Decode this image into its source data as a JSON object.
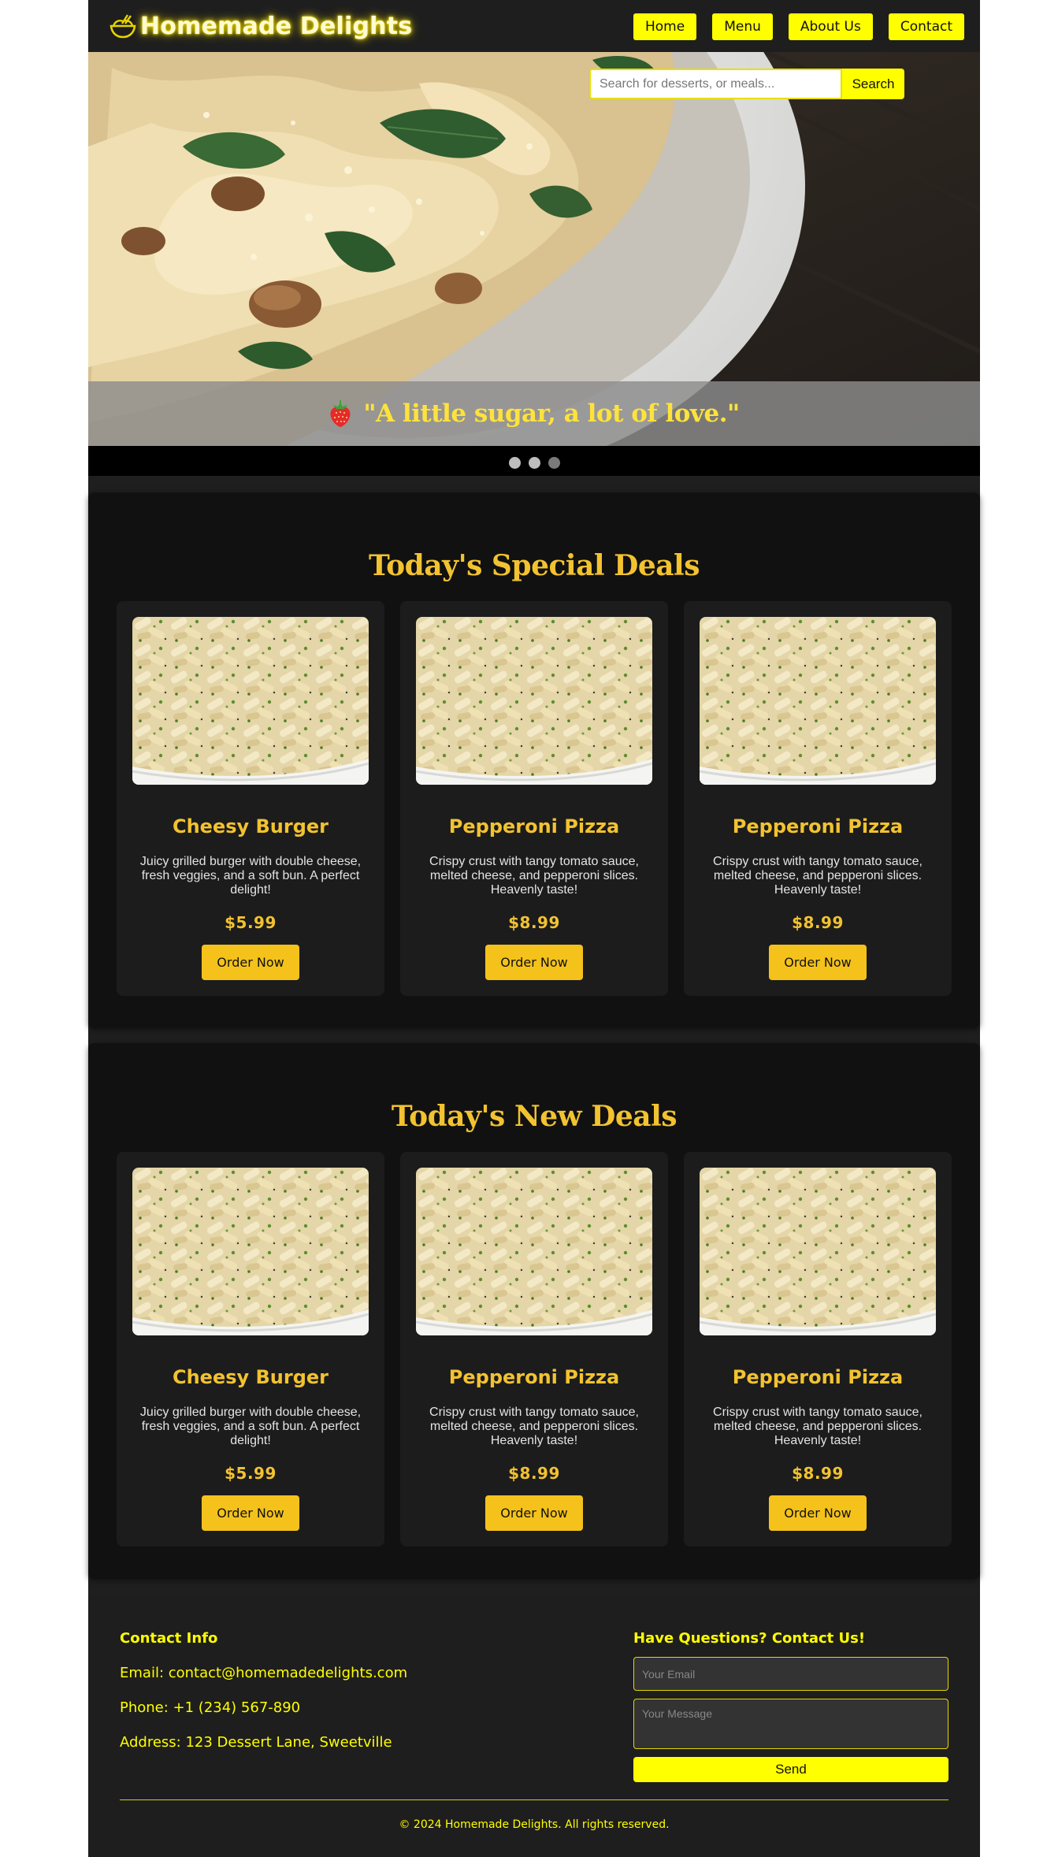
{
  "header": {
    "brand": "Homemade Delights",
    "logo_icon": "food-bowl-icon",
    "nav": [
      "Home",
      "Menu",
      "About Us",
      "Contact"
    ]
  },
  "hero": {
    "search": {
      "placeholder": "Search for desserts, or meals...",
      "value": "",
      "button": "Search"
    },
    "tagline": "\"A little sugar, a lot of love.\"",
    "tagline_icon": "strawberry-icon",
    "slides": 3,
    "active_slide": 1
  },
  "sections": [
    {
      "title": "Today's Special Deals",
      "items": [
        {
          "name": "Cheesy Burger",
          "description": "Juicy grilled burger with double cheese, fresh veggies, and a soft bun. A perfect delight!",
          "price": "$5.99",
          "button": "Order Now"
        },
        {
          "name": "Pepperoni Pizza",
          "description": "Crispy crust with tangy tomato sauce, melted cheese, and pepperoni slices. Heavenly taste!",
          "price": "$8.99",
          "button": "Order Now"
        },
        {
          "name": "Pepperoni Pizza",
          "description": "Crispy crust with tangy tomato sauce, melted cheese, and pepperoni slices. Heavenly taste!",
          "price": "$8.99",
          "button": "Order Now"
        }
      ]
    },
    {
      "title": "Today's New Deals",
      "items": [
        {
          "name": "Cheesy Burger",
          "description": "Juicy grilled burger with double cheese, fresh veggies, and a soft bun. A perfect delight!",
          "price": "$5.99",
          "button": "Order Now"
        },
        {
          "name": "Pepperoni Pizza",
          "description": "Crispy crust with tangy tomato sauce, melted cheese, and pepperoni slices. Heavenly taste!",
          "price": "$8.99",
          "button": "Order Now"
        },
        {
          "name": "Pepperoni Pizza",
          "description": "Crispy crust with tangy tomato sauce, melted cheese, and pepperoni slices. Heavenly taste!",
          "price": "$8.99",
          "button": "Order Now"
        }
      ]
    }
  ],
  "footer": {
    "contact_heading": "Contact Info",
    "email": "Email: contact@homemadedelights.com",
    "phone": "Phone: +1 (234) 567-890",
    "address": "Address: 123 Dessert Lane, Sweetville",
    "form_heading": "Have Questions? Contact Us!",
    "email_placeholder": "Your Email",
    "message_placeholder": "Your Message",
    "send_button": "Send",
    "copyright": "© 2024 Homemade Delights. All rights reserved."
  },
  "colors": {
    "accent": "#ffff00",
    "gold": "#f2c230",
    "header_bg": "#1e1e1e",
    "section_bg": "#111111",
    "card_bg": "#1c1c1c"
  }
}
